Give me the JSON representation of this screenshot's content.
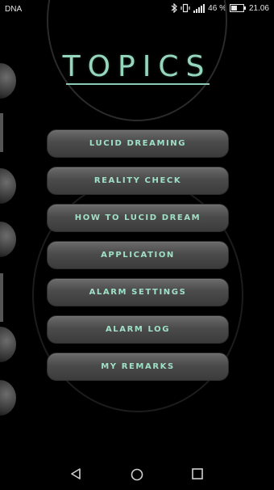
{
  "status_bar": {
    "carrier": "DNA",
    "battery": "46 %",
    "time": "21.06",
    "icons": [
      "bluetooth-icon",
      "vibrate-icon",
      "signal-icon",
      "battery-icon"
    ]
  },
  "title": "TOPICS",
  "menu": {
    "items": [
      {
        "label": "LUCID DREAMING"
      },
      {
        "label": "REALITY CHECK"
      },
      {
        "label": "HOW TO LUCID DREAM"
      },
      {
        "label": "APPLICATION"
      },
      {
        "label": "ALARM SETTINGS"
      },
      {
        "label": "ALARM LOG"
      },
      {
        "label": "MY REMARKS"
      }
    ]
  },
  "nav_bar": {
    "icons": [
      "back-icon",
      "home-icon",
      "recents-icon"
    ]
  },
  "colors": {
    "accent": "#95d7bd",
    "button": "#4b4b4b",
    "background": "#000000"
  }
}
